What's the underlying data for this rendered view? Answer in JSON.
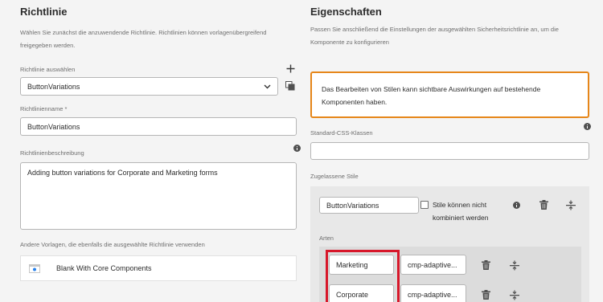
{
  "left": {
    "heading": "Richtlinie",
    "description": "Wählen Sie zunächst die anzuwendende Richtlinie. Richtlinien können vorlagenübergreifend freigegeben werden.",
    "select_label": "Richtlinie auswählen",
    "select_value": "ButtonVariations",
    "name_label": "Richtlinienname *",
    "name_value": "ButtonVariations",
    "description_label": "Richtlinienbeschreibung",
    "description_value": "Adding button variations for Corporate and Marketing forms",
    "other_templates_label": "Andere Vorlagen, die ebenfalls die ausgewählte Richtlinie verwenden",
    "template_item": "Blank With Core Components"
  },
  "right": {
    "heading": "Eigenschaften",
    "description": "Passen Sie anschließend die Einstellungen der ausgewählten Sicherheitsrichtlinie an, um die Komponente zu konfigurieren",
    "warning": "Das Bearbeiten von Stilen kann sichtbare Auswirkungen auf bestehende Komponenten haben.",
    "css_label": "Standard-CSS-Klassen",
    "css_value": "",
    "styles_label": "Zugelassene Stile",
    "group_name": "ButtonVariations",
    "combine_label": "Stile können nicht kombiniert werden",
    "types_label": "Arten",
    "types": [
      {
        "name": "Marketing",
        "class": "cmp-adaptive..."
      },
      {
        "name": "Corporate",
        "class": "cmp-adaptive..."
      }
    ]
  },
  "colors": {
    "warning_border": "#e68619",
    "highlight": "#d7172a",
    "background": "#f4f4f4"
  }
}
